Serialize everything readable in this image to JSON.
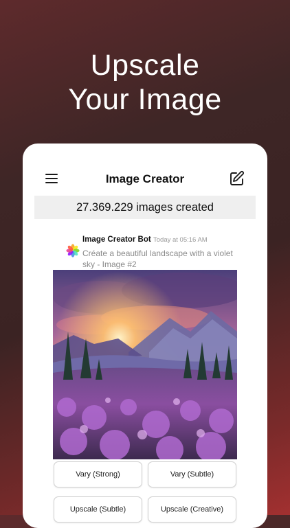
{
  "hero": {
    "line1": "Upscale",
    "line2": "Your Image"
  },
  "navbar": {
    "title": "Image Creator",
    "menu_icon": "hamburger-menu-icon",
    "compose_icon": "compose-icon"
  },
  "counter": {
    "text": "27.369.229 images created"
  },
  "message": {
    "avatar_icon": "photos-flower-icon",
    "sender": "Image Creator Bot",
    "timestamp": "Today at 05:16 AM",
    "prompt": "Créate a beautiful landscape with a violet sky  - Image #2"
  },
  "actions": {
    "vary_strong": "Vary (Strong)",
    "vary_subtle": "Vary (Subtle)",
    "upscale_subtle": "Upscale (Subtle)",
    "upscale_creative": "Upscale (Creative)"
  }
}
